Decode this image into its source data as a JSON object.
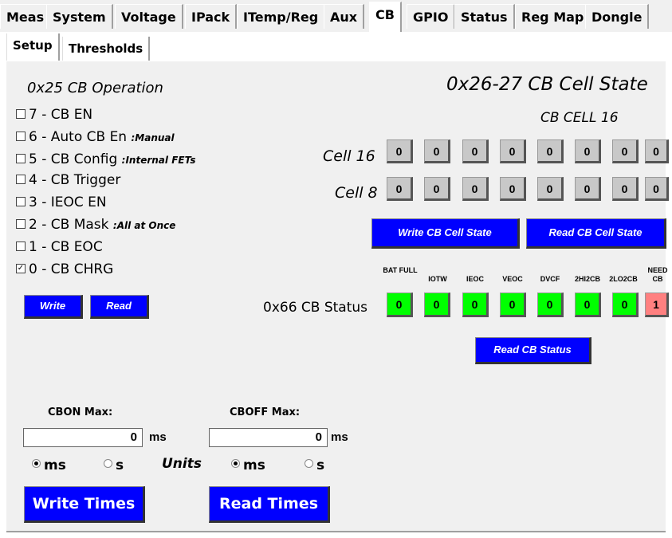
{
  "tabs": [
    "Meas",
    "System",
    "Voltage",
    "IPack",
    "ITemp/Reg",
    "Aux",
    "CB",
    "GPIO",
    "Status",
    "Reg Map",
    "Dongle"
  ],
  "active_tab": "CB",
  "subtabs": [
    "Setup",
    "Thresholds"
  ],
  "cb_operation": {
    "title": "0x25 CB Operation",
    "items": [
      {
        "label": "7 - CB EN",
        "note": "",
        "checked": false
      },
      {
        "label": "6 - Auto CB En",
        "note": ":Manual",
        "checked": false
      },
      {
        "label": "5 - CB Config",
        "note": ":Internal FETs",
        "checked": false
      },
      {
        "label": "4 - CB Trigger",
        "note": "",
        "checked": false
      },
      {
        "label": "3 - IEOC EN",
        "note": "",
        "checked": false
      },
      {
        "label": "2 - CB Mask",
        "note": ":All at Once",
        "checked": false
      },
      {
        "label": "1 - CB EOC",
        "note": "",
        "checked": false
      },
      {
        "label": "0 - CB CHRG",
        "note": "",
        "checked": true
      }
    ],
    "write_label": "Write",
    "read_label": "Read"
  },
  "cell_state": {
    "title": "0x26-27 CB Cell State",
    "subtitle": "CB CELL 16",
    "row1_label": "Cell 16",
    "row2_label": "Cell 8",
    "row1": [
      "0",
      "0",
      "0",
      "0",
      "0",
      "0",
      "0",
      "0"
    ],
    "row2": [
      "0",
      "0",
      "0",
      "0",
      "0",
      "0",
      "0",
      "0"
    ],
    "write_label": "Write CB Cell State",
    "read_label": "Read CB Cell State"
  },
  "cb_status": {
    "label": "0x66 CB Status",
    "headers": [
      "BAT FULL",
      "IOTW",
      "IEOC",
      "VEOC",
      "DVCF",
      "2HI2CB",
      "2LO2CB",
      "NEED CB"
    ],
    "values": [
      "0",
      "0",
      "0",
      "0",
      "0",
      "0",
      "0",
      "1"
    ],
    "read_label": "Read CB Status",
    "colors": {
      "ok": "#00ff00",
      "alert": "#ff8080"
    }
  },
  "times": {
    "cbon_label": "CBON Max:",
    "cboff_label": "CBOFF Max:",
    "cbon_value": "0",
    "cboff_value": "0",
    "unit_ms": "ms",
    "unit_s": "s",
    "units_label": "Units",
    "write_label": "Write Times",
    "read_label": "Read Times"
  }
}
